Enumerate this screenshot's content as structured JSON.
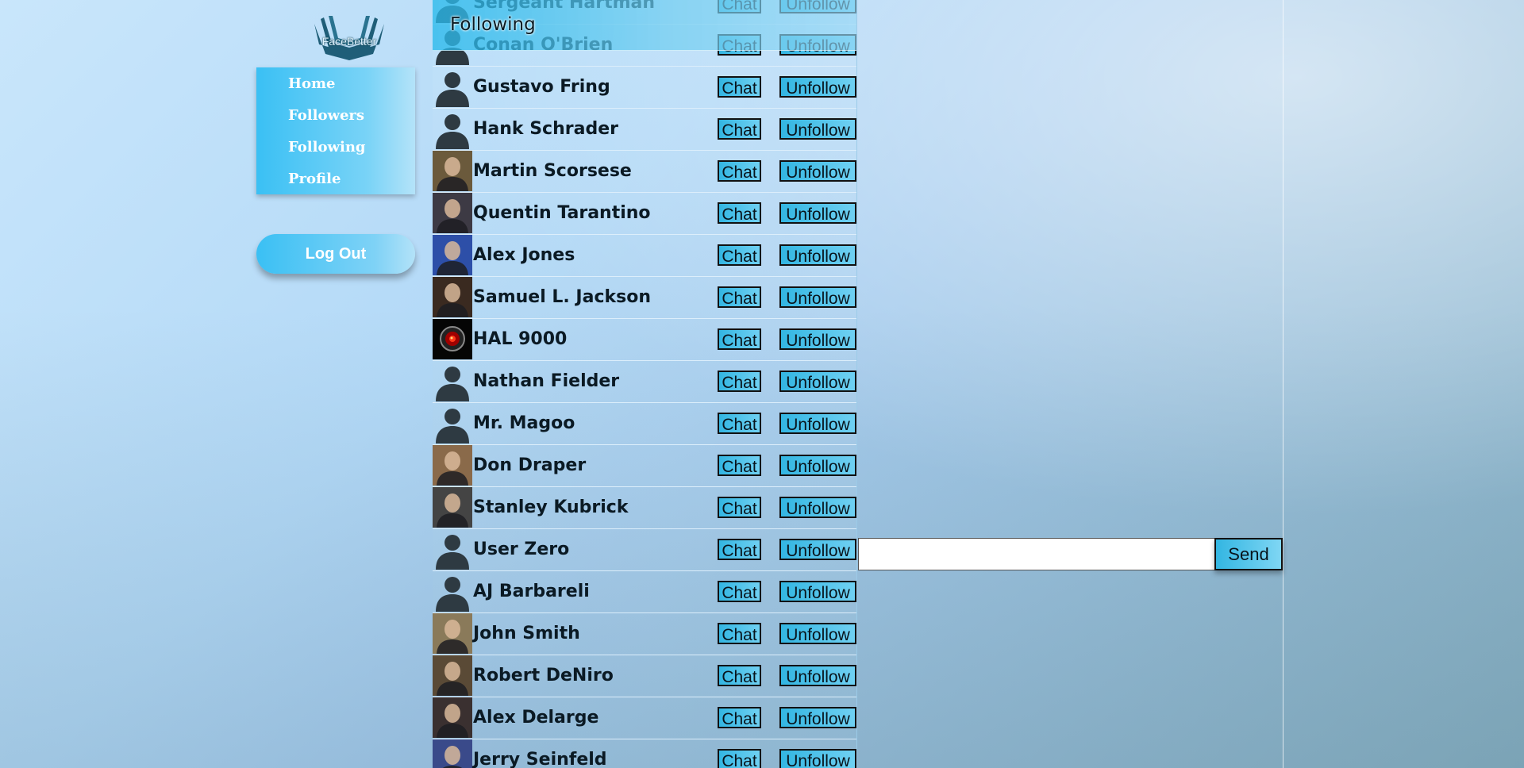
{
  "logo": {
    "text": "FaceBetter"
  },
  "nav": {
    "items": [
      {
        "label": "Home",
        "name": "home"
      },
      {
        "label": "Followers",
        "name": "followers"
      },
      {
        "label": "Following",
        "name": "following"
      },
      {
        "label": "Profile",
        "name": "profile"
      }
    ],
    "logout_label": "Log Out"
  },
  "following": {
    "title": "Following",
    "chat_label": "Chat",
    "unfollow_label": "Unfollow",
    "users": [
      {
        "name": "Sergeant Hartman",
        "avatar": "silhouette"
      },
      {
        "name": "Conan O'Brien",
        "avatar": "silhouette"
      },
      {
        "name": "Gustavo Fring",
        "avatar": "silhouette"
      },
      {
        "name": "Hank Schrader",
        "avatar": "silhouette"
      },
      {
        "name": "Martin Scorsese",
        "avatar": "photo",
        "tone": "#6b5a3c"
      },
      {
        "name": "Quentin Tarantino",
        "avatar": "photo",
        "tone": "#3d3a44"
      },
      {
        "name": "Alex Jones",
        "avatar": "photo",
        "tone": "#2d4fa8"
      },
      {
        "name": "Samuel L. Jackson",
        "avatar": "photo",
        "tone": "#3a2a20"
      },
      {
        "name": "HAL 9000",
        "avatar": "hal"
      },
      {
        "name": "Nathan Fielder",
        "avatar": "silhouette"
      },
      {
        "name": "Mr. Magoo",
        "avatar": "silhouette"
      },
      {
        "name": "Don Draper",
        "avatar": "photo",
        "tone": "#8a6a4a"
      },
      {
        "name": "Stanley Kubrick",
        "avatar": "photo",
        "tone": "#444444"
      },
      {
        "name": "User Zero",
        "avatar": "silhouette"
      },
      {
        "name": "AJ Barbareli",
        "avatar": "silhouette"
      },
      {
        "name": "John Smith",
        "avatar": "photo",
        "tone": "#8a7a5a"
      },
      {
        "name": "Robert DeNiro",
        "avatar": "photo",
        "tone": "#5a4a36"
      },
      {
        "name": "Alex Delarge",
        "avatar": "photo",
        "tone": "#3a3030"
      },
      {
        "name": "Jerry Seinfeld",
        "avatar": "photo",
        "tone": "#3a4a8a"
      }
    ]
  },
  "chat": {
    "input_value": "",
    "input_placeholder": "",
    "send_label": "Send"
  },
  "colors": {
    "accent": "#3ac0f4",
    "button_gradient_end": "#6fd0f2"
  }
}
